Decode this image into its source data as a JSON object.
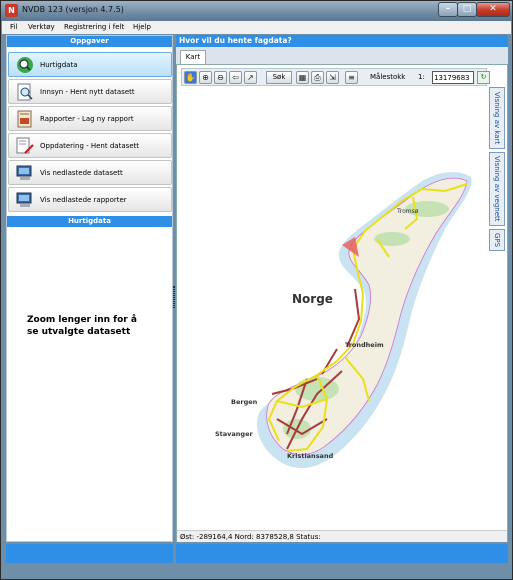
{
  "window": {
    "title": "NVDB 123 (versjon 4.7.5)",
    "icon_name": "nvdb-app-icon",
    "controls": [
      "minimize",
      "maximize",
      "close"
    ]
  },
  "menu": {
    "items": [
      "Fil",
      "Verktøy",
      "Registrering i felt",
      "Hjelp"
    ]
  },
  "left_panel": {
    "header": "Oppgaver",
    "tasks": [
      {
        "label": "Hurtigdata",
        "icon": "magnifier-icon",
        "active": true
      },
      {
        "label": "Innsyn - Hent nytt datasett",
        "icon": "search-document-icon",
        "active": false
      },
      {
        "label": "Rapporter - Lag ny rapport",
        "icon": "report-icon",
        "active": false
      },
      {
        "label": "Oppdatering - Hent datasett",
        "icon": "edit-document-icon",
        "active": false
      },
      {
        "label": "Vis nedlastede datasett",
        "icon": "computer-icon",
        "active": false
      },
      {
        "label": "Vis nedlastede rapporter",
        "icon": "computer-icon",
        "active": false
      }
    ],
    "section_header": "Hurtigdata",
    "hint": "Zoom lenger inn for å se utvalgte datasett"
  },
  "right_panel": {
    "header": "Hvor vil du hente fagdata?",
    "tab": "Kart",
    "toolbar": {
      "search_label": "Søk",
      "scale_label": "Målestokk",
      "scale_prefix": "1:",
      "scale_value": "13179683"
    },
    "side_tabs": [
      "Visning av kart",
      "Visning av vegnett",
      "GPS"
    ],
    "map_labels": {
      "country": "Norge",
      "cities": [
        "Tromsø",
        "Trondheim",
        "Bergen",
        "Stavanger",
        "Kristiansand"
      ]
    },
    "status": {
      "ost_label": "Øst:",
      "ost_value": "-289164,4",
      "nord_label": "Nord:",
      "nord_value": "8378528,8",
      "status_label": "Status:"
    }
  },
  "colors": {
    "header_blue": "#2f8fe6",
    "road_yellow": "#e8e01a",
    "road_red": "#a83a3a",
    "land": "#f2efe0",
    "coast": "#a8d0e8"
  }
}
